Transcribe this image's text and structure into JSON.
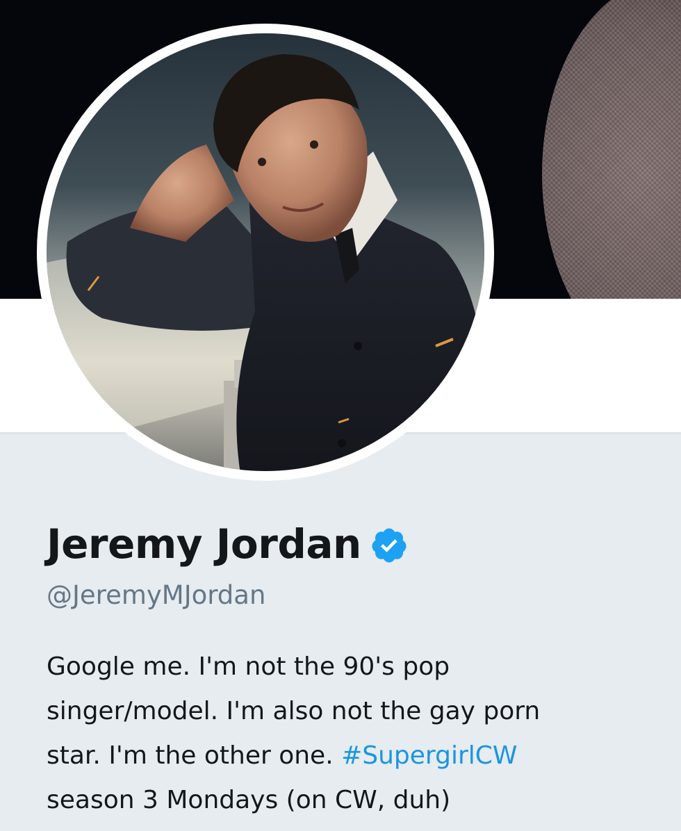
{
  "profile": {
    "name": "Jeremy Jordan",
    "handle": "@JeremyMJordan",
    "verified_icon": "verified-badge-icon",
    "bio": {
      "line1": "Google me. I'm not the 90's pop",
      "line2": "singer/model. I'm also not the gay porn",
      "line3_text": "star. I'm the other one. ",
      "line3_hashtag": "#SupergirlCW",
      "line4": "season 3 Mondays (on CW, duh)"
    }
  },
  "colors": {
    "name_text": "#14171a",
    "handle_text": "#657786",
    "link": "#1b95e0",
    "verified_badge": "#1da1f2",
    "page_background": "#e6ecf0",
    "banner_background": "#05050c"
  }
}
